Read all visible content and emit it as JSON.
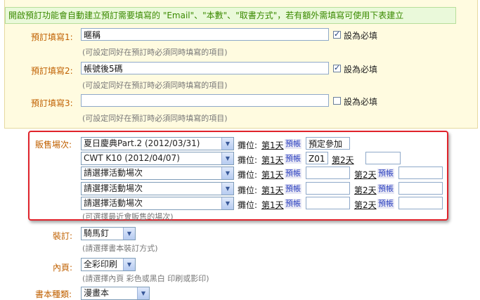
{
  "notice": "開啟預訂功能會自動建立預訂需要填寫的 \"Email\"、\"本數\"、\"取書方式\"，若有額外需填寫可使用下表建立",
  "preorder_fields": [
    {
      "label": "預訂填寫1:",
      "value": "暱稱",
      "required": true,
      "required_label": "設為必填",
      "hint": "(可設定同好在預訂時必須同時填寫的項目)"
    },
    {
      "label": "預訂填寫2:",
      "value": "帳號後5碼",
      "required": true,
      "required_label": "設為必填",
      "hint": "(可設定同好在預訂時必須同時填寫的項目)"
    },
    {
      "label": "預訂填寫3:",
      "value": "",
      "required": false,
      "required_label": "設為必填",
      "hint": "(可設定同好在預訂時必須同時填寫的項目)"
    }
  ],
  "sales": {
    "label": "販售場次:",
    "booth_label": "攤位:",
    "day1": "第1天",
    "day2": "第2天",
    "book_label": "預帳",
    "rows": [
      {
        "event": "夏日慶典Part.2 (2012/03/31)",
        "day1_value": "預定參加",
        "day2": false
      },
      {
        "event": "CWT K10 (2012/04/07)",
        "day1_value": "Z01",
        "day2": true,
        "day2_value": ""
      },
      {
        "event": "請選擇活動場次",
        "day1_value": "",
        "day2": true,
        "day2_value": ""
      },
      {
        "event": "請選擇活動場次",
        "day1_value": "",
        "day2": true,
        "day2_value": ""
      },
      {
        "event": "請選擇活動場次",
        "day1_value": "",
        "day2": true,
        "day2_value": ""
      }
    ],
    "hint": "(可選擇最近會販售的場次)"
  },
  "binding": {
    "label": "裝訂:",
    "value": "騎馬釘",
    "hint": "(請選擇書本裝訂方式)"
  },
  "pages": {
    "label": "內頁:",
    "value": "全彩印刷",
    "hint": "(請選擇內頁 彩色或黑白 印刷或影印)"
  },
  "extra": {
    "label": "書本種類:",
    "value": "漫畫本"
  },
  "colors": {
    "label": "#c06000",
    "notice_text": "#3a8a00",
    "highlight": "#e0232b"
  }
}
